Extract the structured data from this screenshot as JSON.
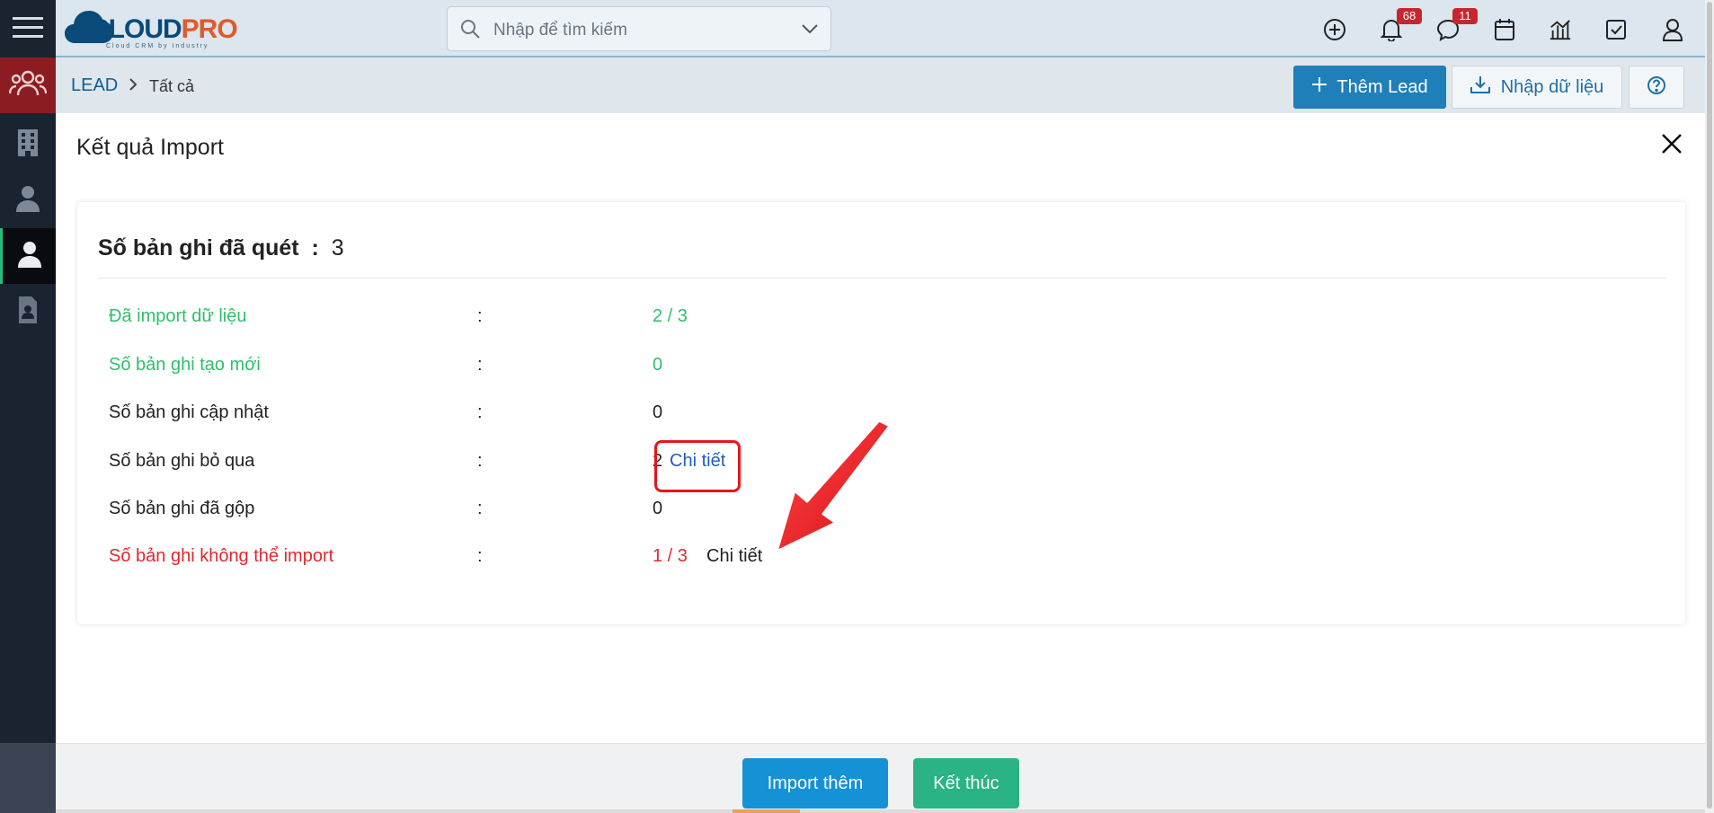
{
  "header": {
    "logo_text_a": "CLOUD",
    "logo_text_b": "PRO",
    "logo_tagline": "Cloud CRM by Industry",
    "search_placeholder": "Nhập để tìm kiếm",
    "notifications_count": "68",
    "messages_count": "11"
  },
  "breadcrumb": {
    "module": "LEAD",
    "current": "Tất cả"
  },
  "actions": {
    "add_label": "Thêm Lead",
    "import_label": "Nhập dữ liệu"
  },
  "modal": {
    "title": "Kết quả Import",
    "scanned_label": "Số bản ghi đã quét",
    "scanned_sep": ":",
    "scanned_value": "3",
    "rows": [
      {
        "label": "Đã import dữ liệu",
        "value": "2 / 3",
        "tone": "green"
      },
      {
        "label": "Số bản ghi tạo mới",
        "value": "0",
        "tone": "green"
      },
      {
        "label": "Số bản ghi cập nhật",
        "value": "0",
        "tone": "normal"
      },
      {
        "label": "Số bản ghi bỏ qua",
        "value": "2",
        "tone": "normal",
        "link": "Chi tiết"
      },
      {
        "label": "Số bản ghi đã gộp",
        "value": "0",
        "tone": "normal"
      },
      {
        "label": "Số bản ghi không thể import",
        "value": "1 / 3",
        "tone": "red",
        "link": "Chi tiết"
      }
    ],
    "colon": ":"
  },
  "footer": {
    "import_more_label": "Import thêm",
    "finish_label": "Kết thúc"
  },
  "colors": {
    "brand": "#0b5f96",
    "primary_button": "#1f7fb8",
    "success_text": "#2fbf6a",
    "error_text": "#e0282f",
    "finish_button": "#2ab384",
    "annotation": "#e8141c"
  }
}
